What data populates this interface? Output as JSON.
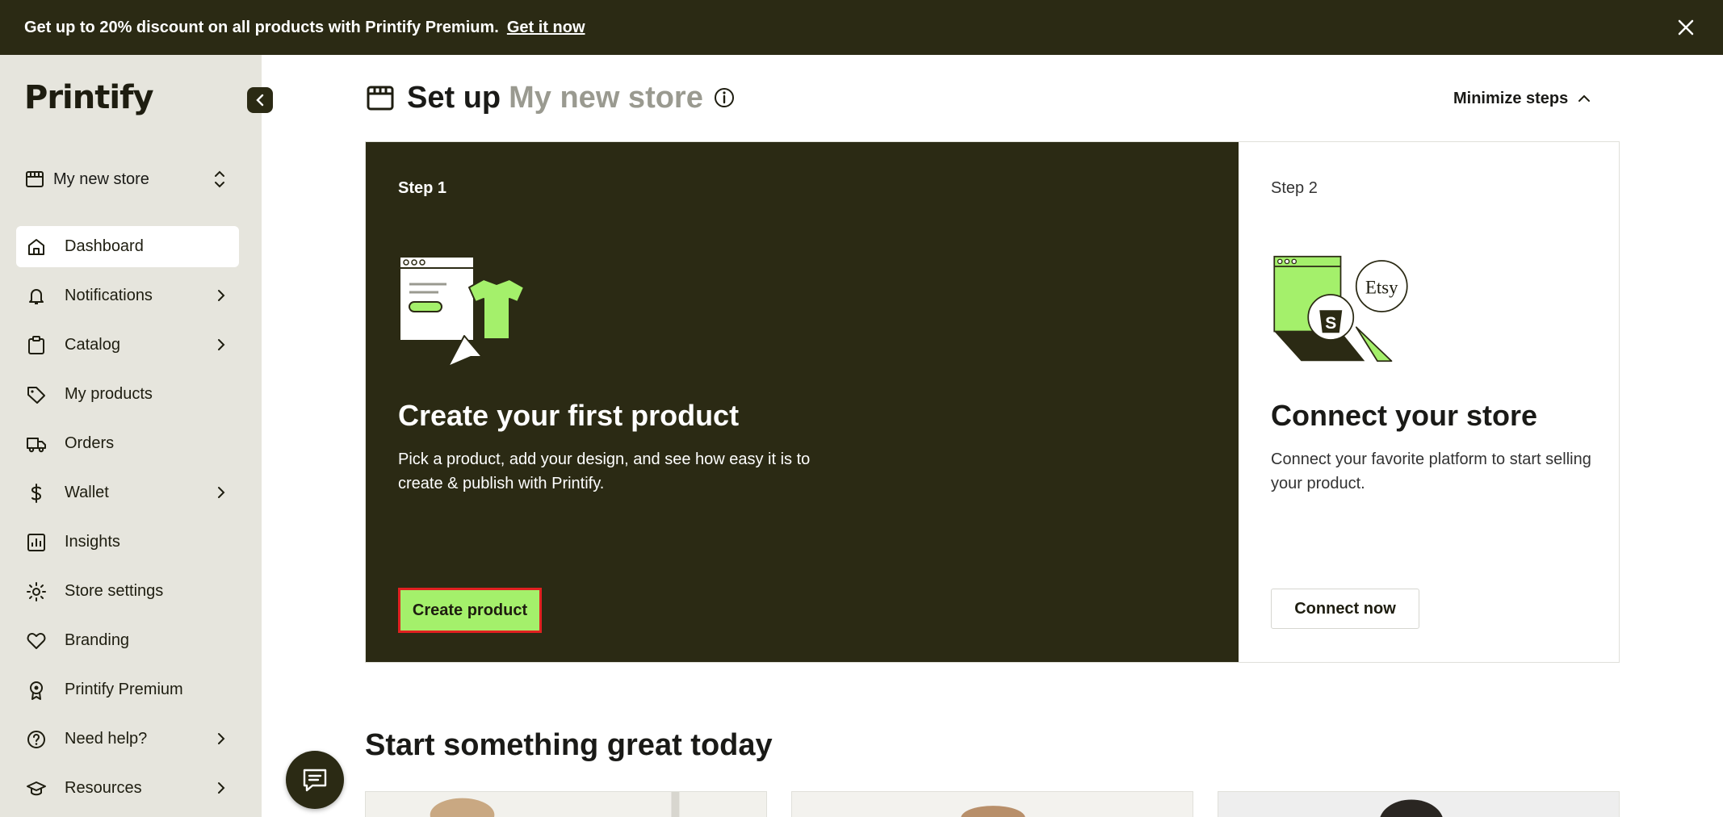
{
  "banner": {
    "text": "Get up to 20% discount on all products with Printify Premium.",
    "cta": "Get it now"
  },
  "sidebar": {
    "logo": "Printify",
    "store_name": "My new store",
    "items": [
      {
        "label": "Dashboard",
        "icon": "home-icon",
        "active": true,
        "has_chevron": false
      },
      {
        "label": "Notifications",
        "icon": "bell-icon",
        "has_chevron": true
      },
      {
        "label": "Catalog",
        "icon": "clipboard-icon",
        "has_chevron": true
      },
      {
        "label": "My products",
        "icon": "tag-icon",
        "has_chevron": false
      },
      {
        "label": "Orders",
        "icon": "truck-icon",
        "has_chevron": false
      },
      {
        "label": "Wallet",
        "icon": "dollar-icon",
        "has_chevron": true
      },
      {
        "label": "Insights",
        "icon": "chart-icon",
        "has_chevron": false
      },
      {
        "label": "Store settings",
        "icon": "gear-icon",
        "has_chevron": false
      },
      {
        "label": "Branding",
        "icon": "heart-icon",
        "has_chevron": false
      },
      {
        "label": "Printify Premium",
        "icon": "badge-icon",
        "has_chevron": false
      },
      {
        "label": "Need help?",
        "icon": "help-icon",
        "has_chevron": true
      },
      {
        "label": "Resources",
        "icon": "graduation-cap-icon",
        "has_chevron": true
      }
    ]
  },
  "setup": {
    "title_prefix": "Set up",
    "store_name": "My new store",
    "minimize_label": "Minimize steps",
    "step1": {
      "label": "Step 1",
      "title": "Create your first product",
      "description": "Pick a product, add your design, and see how easy it is to create & publish with Printify.",
      "button": "Create product"
    },
    "step2": {
      "label": "Step 2",
      "title": "Connect your store",
      "description": "Connect your favorite platform to start selling your product.",
      "button": "Connect now",
      "badge": "Etsy"
    }
  },
  "section_title": "Start something great today",
  "colors": {
    "banner_bg": "#2b2a14",
    "accent_green": "#a4f06b",
    "sidebar_bg": "#e6e5dd",
    "highlight_border": "#e02020"
  }
}
